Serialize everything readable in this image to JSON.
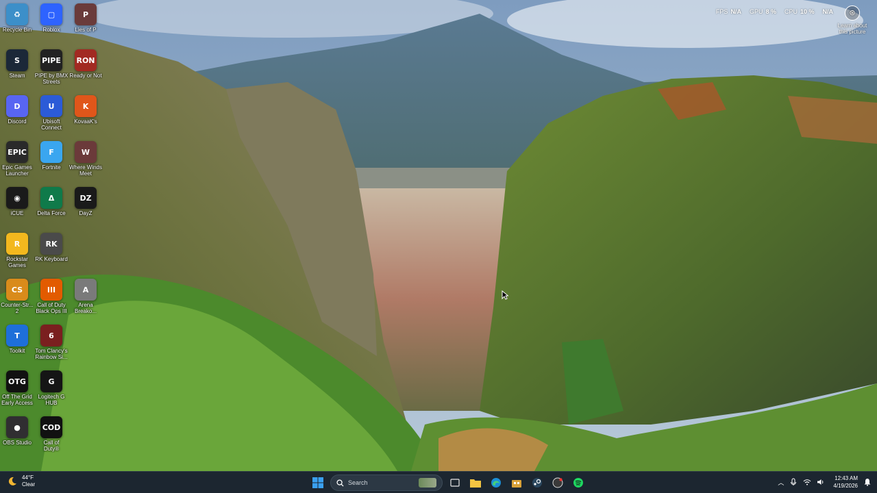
{
  "desktop_icons": [
    {
      "label": "Recycle Bin",
      "color": "#3c8fc9",
      "glyph": "♻"
    },
    {
      "label": "Roblox",
      "color": "#2e63ff",
      "glyph": "▢"
    },
    {
      "label": "Lies of P",
      "color": "#6a3b3b",
      "glyph": "P"
    },
    {
      "label": "Steam",
      "color": "#1b2838",
      "glyph": "S"
    },
    {
      "label": "PIPE by BMX\nStreets",
      "color": "#222222",
      "glyph": "PIPE"
    },
    {
      "label": "Ready or Not",
      "color": "#a22a22",
      "glyph": "RON"
    },
    {
      "label": "Discord",
      "color": "#5865f2",
      "glyph": "D"
    },
    {
      "label": "Ubisoft\nConnect",
      "color": "#2b5bd7",
      "glyph": "U"
    },
    {
      "label": "KovaaK's",
      "color": "#e0561a",
      "glyph": "K"
    },
    {
      "label": "Epic Games\nLauncher",
      "color": "#2a2a2a",
      "glyph": "EPIC"
    },
    {
      "label": "Fortnite",
      "color": "#3aa6f0",
      "glyph": "F"
    },
    {
      "label": "Where Winds\nMeet",
      "color": "#6b3a3a",
      "glyph": "W"
    },
    {
      "label": "iCUE",
      "color": "#1a1a1a",
      "glyph": "◉"
    },
    {
      "label": "Delta Force",
      "color": "#0f7a4a",
      "glyph": "Δ"
    },
    {
      "label": "DayZ",
      "color": "#1a1a1a",
      "glyph": "DZ"
    },
    {
      "label": "Rockstar\nGames",
      "color": "#f3b81e",
      "glyph": "R"
    },
    {
      "label": "RK Keyboard",
      "color": "#4a4a4a",
      "glyph": "RK"
    },
    {
      "label": "Counter-Str...\n2",
      "color": "#d98b1b",
      "glyph": "CS"
    },
    {
      "label": "Call of Duty\nBlack Ops III",
      "color": "#e25b00",
      "glyph": "III"
    },
    {
      "label": "Arena\nBreako...",
      "color": "#7a7a7a",
      "glyph": "A"
    },
    {
      "label": "Toolkit",
      "color": "#1e6fd9",
      "glyph": "T"
    },
    {
      "label": "Tom Clancy's\nRainbow Si...",
      "color": "#7a1f1f",
      "glyph": "6"
    },
    {
      "label": "Off The Grid\nEarly Access",
      "color": "#111111",
      "glyph": "OTG"
    },
    {
      "label": "Logitech G\nHUB",
      "color": "#151515",
      "glyph": "G"
    },
    {
      "label": "OBS Studio",
      "color": "#302e31",
      "glyph": "●"
    },
    {
      "label": "Call of\nDuty®",
      "color": "#111111",
      "glyph": "COD"
    }
  ],
  "overlay_stats": [
    {
      "label": "FPS",
      "value": "N/A"
    },
    {
      "label": "GPU",
      "value": "8 %"
    },
    {
      "label": "CPU",
      "value": "10 %"
    },
    {
      "label": "",
      "value": "N/A"
    }
  ],
  "learn_picture": {
    "label": "Learn about\nthis picture"
  },
  "taskbar": {
    "weather": {
      "temp": "44°F",
      "condition": "Clear"
    },
    "search_placeholder": "Search",
    "apps": [
      "file-explorer",
      "edge",
      "store",
      "steam",
      "obs",
      "spotify"
    ],
    "time": "12:43 AM",
    "date": "4/19/2026"
  },
  "colors": {
    "taskbar": "#1c2630",
    "accent": "#0078d4"
  }
}
